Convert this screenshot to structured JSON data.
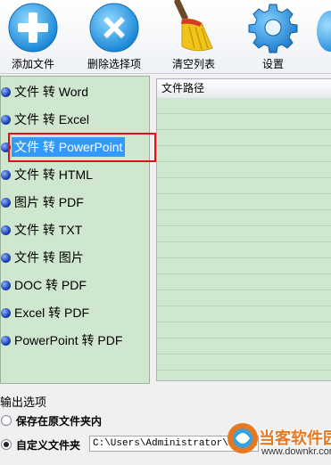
{
  "toolbar": {
    "add_label": "添加文件",
    "delete_label": "删除选择项",
    "clear_label": "清空列表",
    "settings_label": "设置"
  },
  "conversions": [
    {
      "label": "文件 转 Word",
      "selected": false
    },
    {
      "label": "文件 转 Excel",
      "selected": false
    },
    {
      "label": "文件 转 PowerPoint",
      "selected": true
    },
    {
      "label": "文件 转 HTML",
      "selected": false
    },
    {
      "label": "图片 转 PDF",
      "selected": false
    },
    {
      "label": "文件 转 TXT",
      "selected": false
    },
    {
      "label": "文件 转 图片",
      "selected": false
    },
    {
      "label": "DOC 转 PDF",
      "selected": false
    },
    {
      "label": "Excel 转 PDF",
      "selected": false
    },
    {
      "label": "PowerPoint 转 PDF",
      "selected": false
    }
  ],
  "file_list": {
    "header": "文件路径"
  },
  "output": {
    "title": "输出选项",
    "option_original": "保存在原文件夹内",
    "option_custom": "自定义文件夹",
    "selected": "custom",
    "custom_path": "C:\\Users\\Administrator\\Desktop"
  },
  "watermark": {
    "brand": "当客软件园",
    "url": "www.downkr.com"
  },
  "colors": {
    "selection": "#3399ff",
    "highlight_box": "#e0101a",
    "panel_green": "#cfe7cf"
  }
}
